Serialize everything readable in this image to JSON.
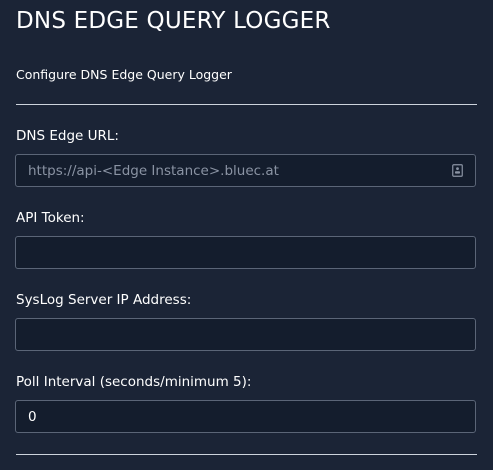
{
  "header": {
    "title": "DNS EDGE QUERY LOGGER",
    "subtitle": "Configure DNS Edge Query Logger"
  },
  "form": {
    "dns_edge_url": {
      "label": "DNS Edge URL:",
      "value": "",
      "placeholder": "https://api-<Edge Instance>.bluec.at",
      "icon": "contact-card-icon"
    },
    "api_token": {
      "label": "API Token:",
      "value": ""
    },
    "syslog_server": {
      "label": "SysLog Server IP Address:",
      "value": ""
    },
    "poll_interval": {
      "label": "Poll Interval (seconds/minimum 5):",
      "value": "0"
    }
  },
  "colors": {
    "background": "#1b2436",
    "field_background": "#141d2d",
    "field_border": "#5b6577",
    "divider": "#cdd3dc",
    "text": "#ffffff",
    "placeholder": "#8a93a3"
  }
}
